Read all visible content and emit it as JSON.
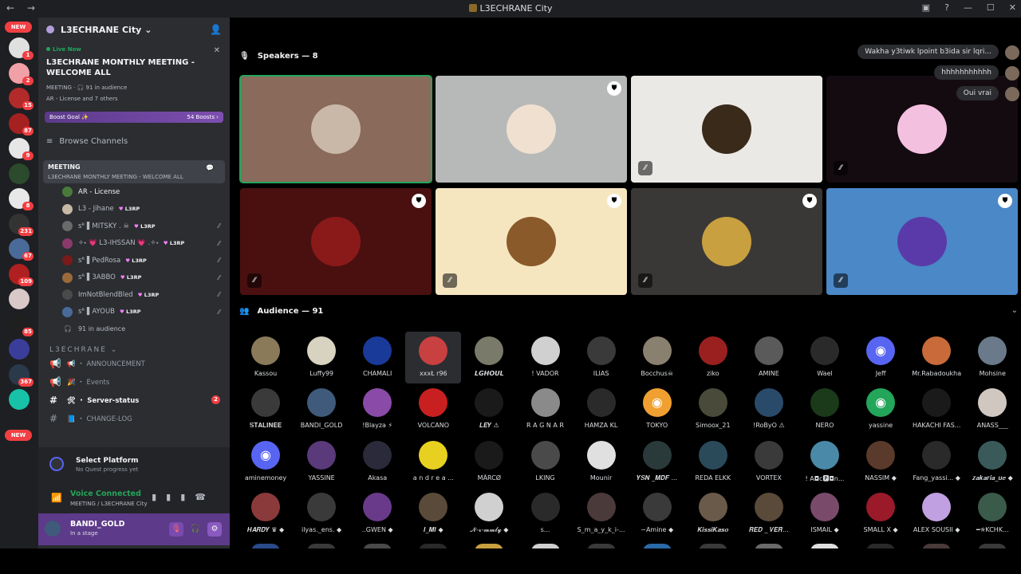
{
  "window": {
    "title": "L3ECHRANE City",
    "nav": "← →",
    "controls": [
      "▣",
      "?",
      "—",
      "☐",
      "✕"
    ]
  },
  "rail": {
    "new_top": "NEW",
    "new_bottom": "NEW",
    "servers": [
      {
        "color": "#e0e0e0",
        "badge": "1"
      },
      {
        "color": "#f2a0a8",
        "badge": "2"
      },
      {
        "color": "#b22a2a",
        "badge": "15"
      },
      {
        "color": "#a52020",
        "badge": "87"
      },
      {
        "color": "#e6e6e6",
        "badge": "9"
      },
      {
        "color": "#2c4a2c",
        "badge": ""
      },
      {
        "color": "#e8e8e8",
        "badge": "8"
      },
      {
        "color": "#333333",
        "badge": "231"
      },
      {
        "color": "#4a6a9a",
        "badge": "67"
      },
      {
        "color": "#b02020",
        "badge": "109"
      },
      {
        "color": "#d8c8c8",
        "badge": ""
      },
      {
        "color": "#1f1f1f",
        "badge": "85"
      },
      {
        "color": "#3a3e9a",
        "badge": ""
      },
      {
        "color": "#2a3a4a",
        "badge": "367"
      },
      {
        "color": "#17c2a8",
        "badge": ""
      }
    ]
  },
  "sidebar": {
    "server_name": "L3ECHRANE City",
    "server_chevron": "⌄",
    "live_tag": "Live Now",
    "live_title": "L3ECHRANE MONTHLY MEETING - WELCOME ALL",
    "live_meta": "MEETING · 🎧 91 in audience",
    "live_speakers": "AR - License and 7 others",
    "boost_label": "Boost Goal ✨",
    "boost_count": "54 Boosts ›",
    "browse": "Browse Channels",
    "active_channel": "MEETING",
    "active_channel_sub": "L3ECHRANE MONTHLY MEETING - WELCOME ALL",
    "members": [
      {
        "name": "AR - License",
        "tag": "",
        "color": "#4a7a3a",
        "muted": false
      },
      {
        "name": "L3 - Jihane",
        "tag": "L3RP",
        "color": "#c7b9a5",
        "muted": false
      },
      {
        "name": "ꜱᴿ ▌MITSKY .  ☠",
        "tag": "L3RP",
        "color": "#6a6a6a",
        "muted": true
      },
      {
        "name": "✧˖ 💗 L3-IHSSAN 💗 .✧˖",
        "tag": "L3RP",
        "color": "#8a3a6a",
        "muted": true
      },
      {
        "name": "ꜱᴿ ▌PedRosa",
        "tag": "L3RP",
        "color": "#7a1a1a",
        "muted": true
      },
      {
        "name": "ꜱᴿ ▌3ABBO",
        "tag": "L3RP",
        "color": "#9a6a3a",
        "muted": true
      },
      {
        "name": "ImNotBlendBled",
        "tag": "L3RP",
        "color": "#4a4a4a",
        "muted": true
      },
      {
        "name": "ꜱᴿ ▌AYOUB",
        "tag": "L3RP",
        "color": "#4a6a9a",
        "muted": true
      }
    ],
    "audience": "91 in audience",
    "category": "L3ECHRANE ⌄",
    "channels": [
      {
        "icon": "📢",
        "name": "📢 ・ ANNOUNCEMENT",
        "bold": false,
        "count": ""
      },
      {
        "icon": "📢",
        "name": "🎉 ・ Events",
        "bold": false,
        "count": ""
      },
      {
        "icon": "#",
        "name": "🛠 ・ Server-status",
        "bold": true,
        "count": "2"
      },
      {
        "icon": "#",
        "name": "📘 ・ CHANGE-LOG",
        "bold": false,
        "count": ""
      }
    ]
  },
  "platform": {
    "title": "Select Platform",
    "sub": "No Quest progress yet"
  },
  "voice": {
    "title": "Voice Connected",
    "sub": "MEETING / L3ECHRANE City"
  },
  "user": {
    "name": "BANDI_GOLD",
    "status": "In a stage"
  },
  "stage": {
    "speakers_title": "Speakers — 8",
    "audience_title": "Audience — 91",
    "tiles": [
      {
        "bg": "#8a6a5a",
        "face": "#c9b8a8",
        "shield": false,
        "mute": false,
        "speaking": true
      },
      {
        "bg": "#b6b9b8",
        "face": "#f0e0d0",
        "shield": true,
        "mute": false,
        "speaking": false
      },
      {
        "bg": "#ebe9e6",
        "face": "#3a2a1a",
        "shield": false,
        "mute": true,
        "speaking": false
      },
      {
        "bg": "#140b10",
        "face": "#f4c0e0",
        "shield": false,
        "mute": true,
        "speaking": false
      },
      {
        "bg": "#4a1010",
        "face": "#8a1a1a",
        "shield": true,
        "mute": true,
        "speaking": false
      },
      {
        "bg": "#f5e6c0",
        "face": "#8a5a2a",
        "shield": true,
        "mute": true,
        "speaking": false
      },
      {
        "bg": "#3a3836",
        "face": "#c8a040",
        "shield": true,
        "mute": true,
        "speaking": false
      },
      {
        "bg": "#4a88c8",
        "face": "#5a3aa8",
        "shield": true,
        "mute": true,
        "speaking": false
      }
    ],
    "chat": [
      "Wakha y3tiwk lpoint b3ida sir lqri...",
      "hhhhhhhhhhh",
      "Oui vrai"
    ],
    "audience": [
      {
        "name": "Kassou",
        "color": "#8a7a5a"
      },
      {
        "name": "Luffy99",
        "color": "#d8d2c0"
      },
      {
        "name": "CHAMALI",
        "color": "#1a3a9a"
      },
      {
        "name": "xxxŁ r96",
        "color": "#c84040"
      },
      {
        "name": "𝙇𝙂𝙃𝙊𝙐𝙇",
        "color": "#7a7a6a"
      },
      {
        "name": "! VADOR",
        "color": "#d0d0d0"
      },
      {
        "name": "ILIAS",
        "color": "#3a3a3a"
      },
      {
        "name": "Bocchus☠",
        "color": "#8a8070"
      },
      {
        "name": "ziko",
        "color": "#9a2020"
      },
      {
        "name": "AMINE",
        "color": "#5a5a5a"
      },
      {
        "name": "Wael",
        "color": "#2a2a2a"
      },
      {
        "name": "Jeff",
        "color": "#5865f2",
        "discord": true
      },
      {
        "name": "Mr.Rabadoukha",
        "color": "#c86a3a"
      },
      {
        "name": "Mohsine",
        "color": "#6a7a8a"
      },
      {
        "name": "𝐒𝐓𝐀𝐋𝐈𝐍𝐄𝐄",
        "color": "#3a3a3a"
      },
      {
        "name": "BANDI_GOLD",
        "color": "#3f5a7a"
      },
      {
        "name": "!Blayza ⚡",
        "color": "#8a4aa8"
      },
      {
        "name": "VOLCANO",
        "color": "#c82020"
      },
      {
        "name": "𝑳𝑬𝒀 ⚠",
        "color": "#1a1a1a"
      },
      {
        "name": "R A G N A R",
        "color": "#8a8a8a"
      },
      {
        "name": "HAMZA KL",
        "color": "#2a2a2a"
      },
      {
        "name": "TOKYO",
        "color": "#f0a030",
        "discord": true
      },
      {
        "name": "Simoox_21",
        "color": "#4a4a3a"
      },
      {
        "name": "!RoByO ⚠",
        "color": "#2a4a6a"
      },
      {
        "name": "NERO",
        "color": "#1a3a1a"
      },
      {
        "name": "yassine",
        "color": "#23a55a",
        "discord": true
      },
      {
        "name": "HAKACHI FAS...",
        "color": "#1a1a1a"
      },
      {
        "name": "ANASS___",
        "color": "#d0c8c0"
      },
      {
        "name": "aminemoney",
        "color": "#5865f2",
        "discord": true
      },
      {
        "name": "YASSINE",
        "color": "#5a3a7a"
      },
      {
        "name": "Akasa",
        "color": "#2a2a3a"
      },
      {
        "name": "a n d r e a ...",
        "color": "#e8d020"
      },
      {
        "name": "MÃRCØ",
        "color": "#1a1a1a"
      },
      {
        "name": "LKING",
        "color": "#4a4a4a"
      },
      {
        "name": "Mounir",
        "color": "#e0e0e0"
      },
      {
        "name": "𝒀𝑺𝑵 _𝑴𝑫𝑭 ...",
        "color": "#2a3a3a"
      },
      {
        "name": "REDA ELKK",
        "color": "#2a4a5a"
      },
      {
        "name": "VORTEX",
        "color": "#3a3a3a"
      },
      {
        "name": "! A◘c🅿◘n...",
        "color": "#4a8aa8"
      },
      {
        "name": "NASSIM ◆",
        "color": "#5a3a2a"
      },
      {
        "name": "Fang_yassi... ◆",
        "color": "#2a2a2a"
      },
      {
        "name": "𝒛𝒂𝒌𝒂𝒓𝒊𝒂_𝒖𝒆 ◆",
        "color": "#3a5a5a"
      },
      {
        "name": "𝑯𝑨𝑹𝑫𝒀 ♛ ◆",
        "color": "#8a3a3a"
      },
      {
        "name": "ilyas._ens. ◆",
        "color": "#3a3a3a"
      },
      {
        "name": "..GWEN ◆",
        "color": "#6a3a8a"
      },
      {
        "name": "𝑰_𝑴𝑰 ◆",
        "color": "#5a4a3a"
      },
      {
        "name": "𝓝-𝓻-𝓶𝓶𝓵𝔂 ◆",
        "color": "#d0d0d0"
      },
      {
        "name": "s...",
        "color": "#2a2a2a"
      },
      {
        "name": "S_m_a_y_k_i-...",
        "color": "#4a3a3a"
      },
      {
        "name": "~Amine ◆",
        "color": "#3a3a3a"
      },
      {
        "name": "𝑲𝒊𝒔𝒔𝒊𝑲𝒂𝒔𝒐",
        "color": "#6a5a4a"
      },
      {
        "name": "𝑹𝑬𝑫 _ 𝑽𝑬𝑹...",
        "color": "#5a4a3a"
      },
      {
        "name": "ISMAIL ◆",
        "color": "#7a4a6a"
      },
      {
        "name": "SMALL X ◆",
        "color": "#9a1a2a"
      },
      {
        "name": "ALEX SOUSII ◆",
        "color": "#c0a0e0"
      },
      {
        "name": "━✯KCHK...",
        "color": "#3a5a4a"
      }
    ]
  }
}
